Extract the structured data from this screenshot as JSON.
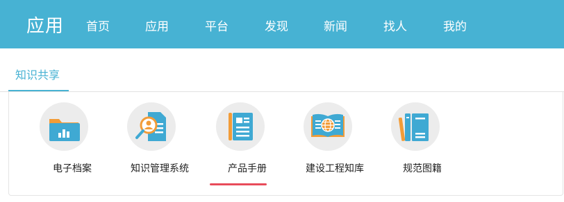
{
  "header": {
    "logo": "应用",
    "nav": [
      "首页",
      "应用",
      "平台",
      "发现",
      "新闻",
      "找人",
      "我的"
    ]
  },
  "tabs": [
    {
      "label": "知识共享",
      "active": true
    }
  ],
  "cards": [
    {
      "label": "电子档案",
      "icon": "folder-chart-icon"
    },
    {
      "label": "知识管理系统",
      "icon": "document-search-icon"
    },
    {
      "label": "产品手册",
      "icon": "manual-book-icon",
      "active": true
    },
    {
      "label": "建设工程知库",
      "icon": "open-book-globe-icon"
    },
    {
      "label": "规范图籍",
      "icon": "binders-icon"
    }
  ],
  "colors": {
    "header_bg": "#47b2d3",
    "accent": "#47b2d3",
    "active_indicator": "#e84b5a",
    "icon_blue": "#3fa9d3",
    "icon_orange": "#f29c38"
  }
}
